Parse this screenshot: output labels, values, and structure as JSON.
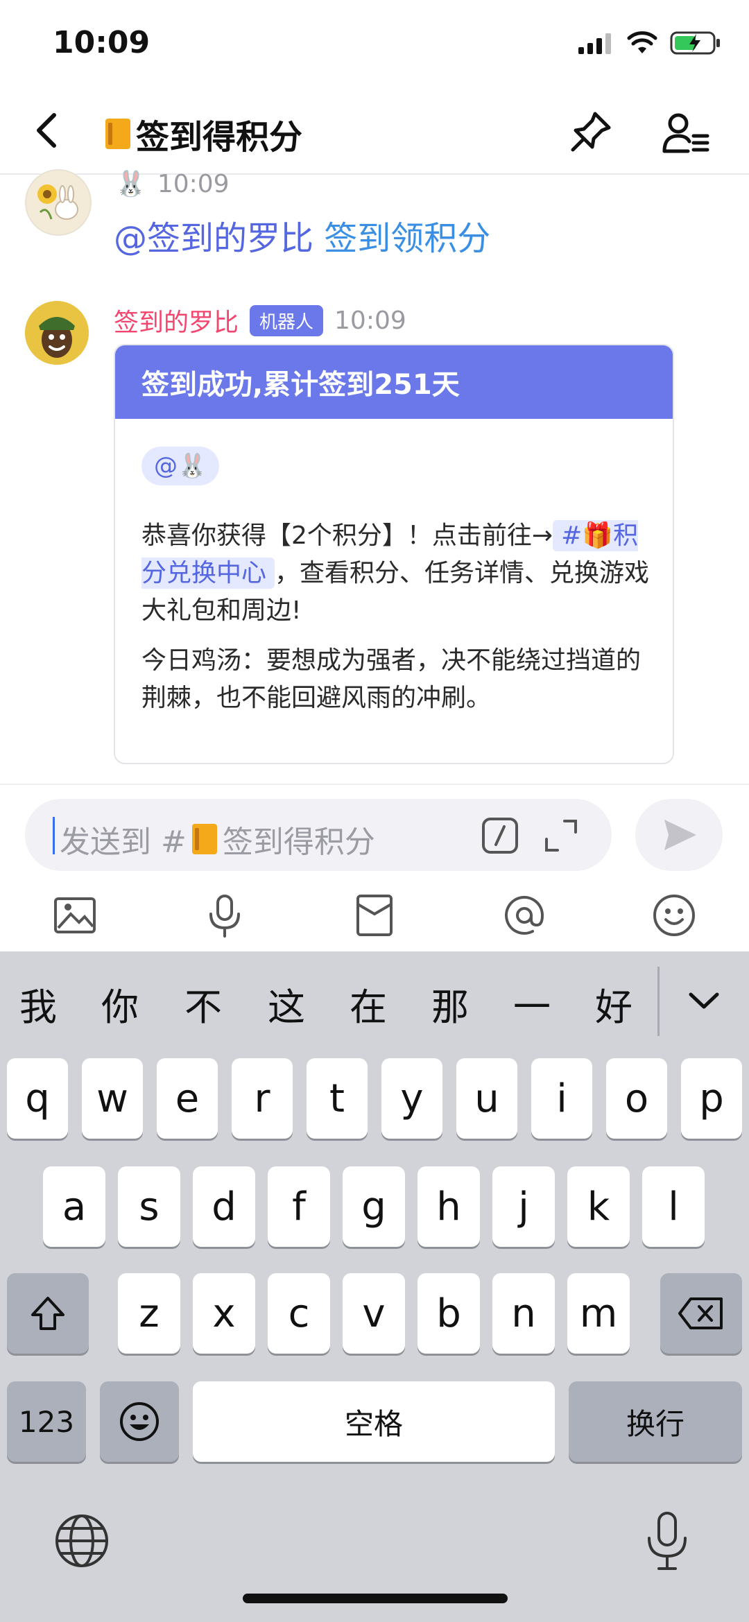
{
  "status_bar": {
    "time": "10:09"
  },
  "header": {
    "title": "签到得积分",
    "title_prefix_icon": "orange-book-icon"
  },
  "messages": [
    {
      "sender_emoji": "🐰",
      "time": "10:09",
      "mention": "@签到的罗比",
      "text": "签到领积分"
    },
    {
      "sender": "签到的罗比",
      "badge": "机器人",
      "time": "10:09",
      "card": {
        "title": "签到成功,累计签到251天",
        "mention_pill": "@🐰",
        "paragraph1_a": "恭喜你获得【2个积分】！点击前往→",
        "channel_link": "#🎁积分兑换中心",
        "paragraph1_b": "，查看积分、任务详情、兑换游戏大礼包和周边!",
        "paragraph2": "今日鸡汤：要想成为强者，决不能绕过挡道的荆棘，也不能回避风雨的冲刷。"
      }
    }
  ],
  "composer": {
    "placeholder_prefix": "发送到 #",
    "placeholder_channel": "签到得积分"
  },
  "keyboard": {
    "candidates": [
      "我",
      "你",
      "不",
      "这",
      "在",
      "那",
      "一",
      "好"
    ],
    "row1": [
      "q",
      "w",
      "e",
      "r",
      "t",
      "y",
      "u",
      "i",
      "o",
      "p"
    ],
    "row2": [
      "a",
      "s",
      "d",
      "f",
      "g",
      "h",
      "j",
      "k",
      "l"
    ],
    "row3": [
      "z",
      "x",
      "c",
      "v",
      "b",
      "n",
      "m"
    ],
    "numbers_key": "123",
    "space_key": "空格",
    "return_key": "换行"
  },
  "colors": {
    "accent": "#6a78ea",
    "mention": "#5466e0",
    "link": "#3a8fe4",
    "bot_name": "#f2466f"
  }
}
